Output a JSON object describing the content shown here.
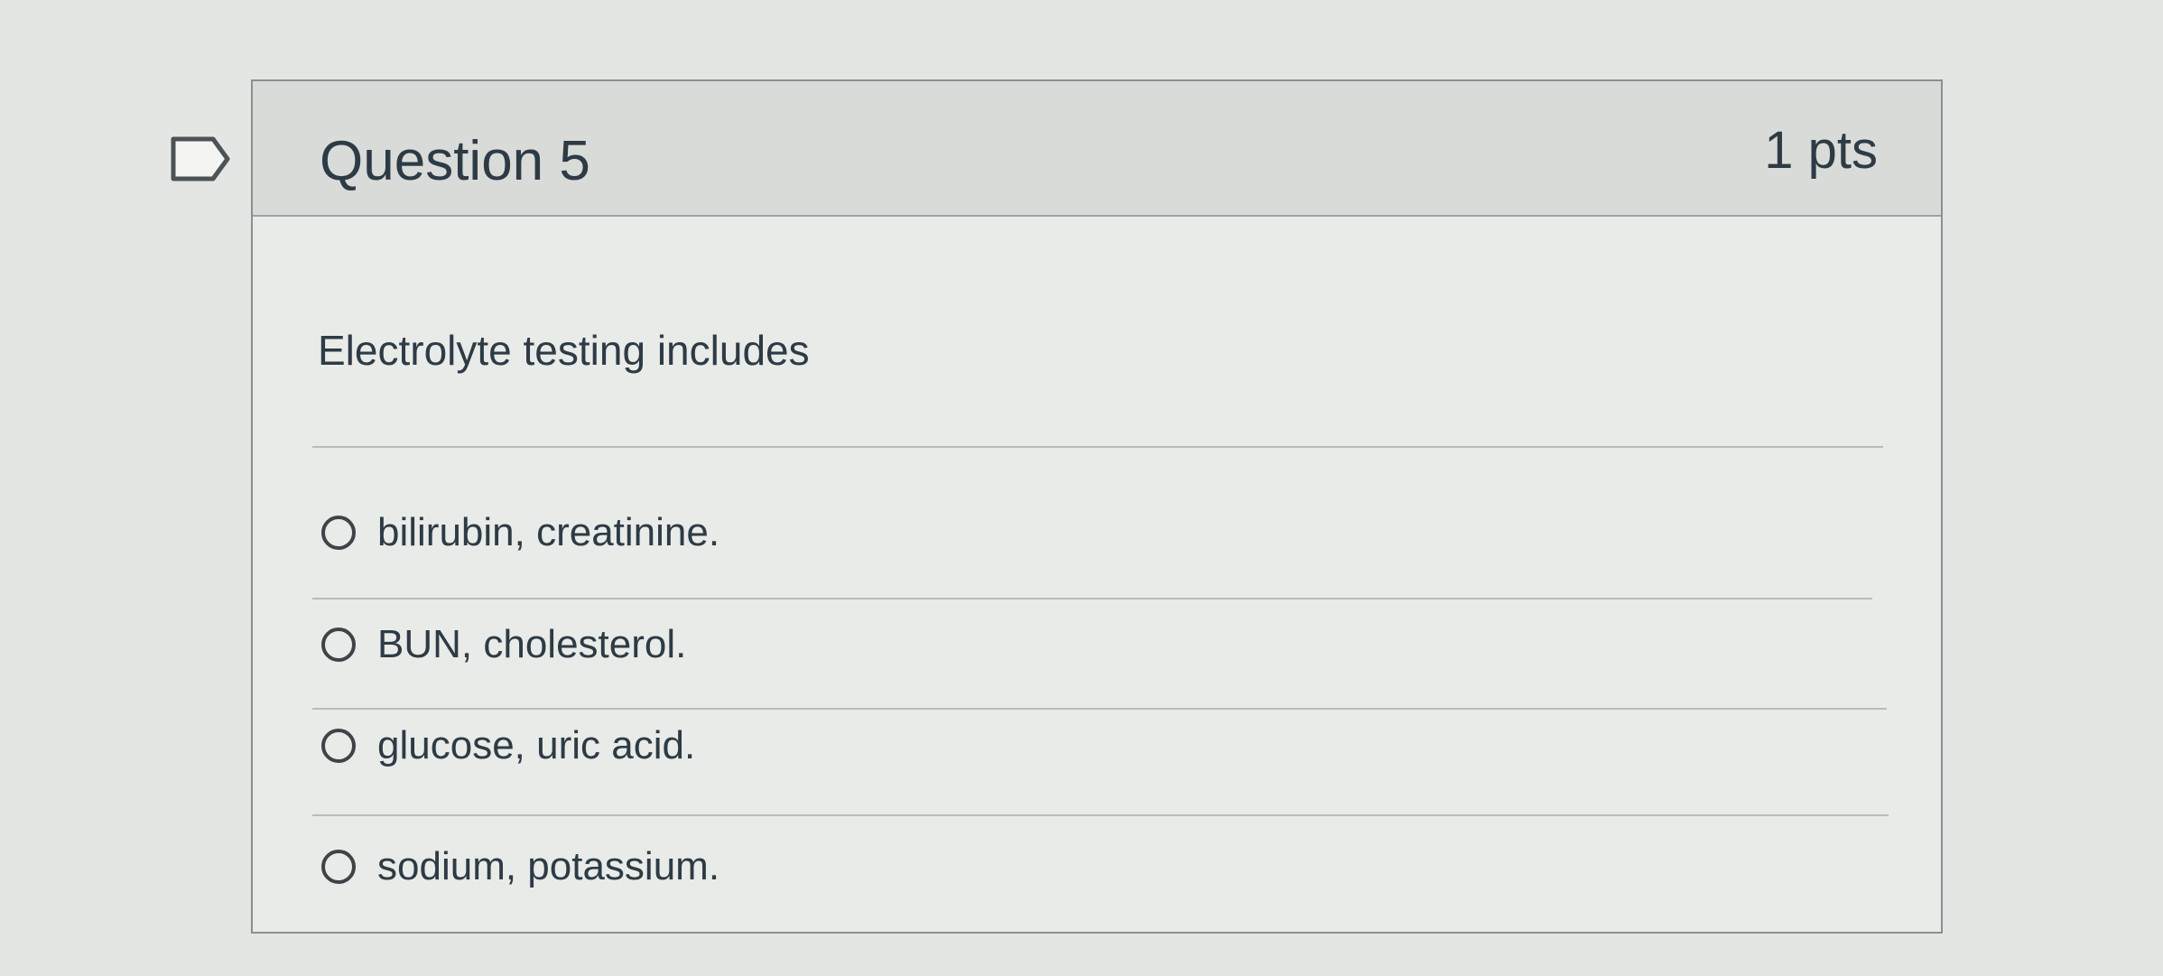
{
  "question": {
    "title": "Question 5",
    "points": "1 pts",
    "text": "Electrolyte testing includes",
    "answers": [
      {
        "label": "bilirubin, creatinine."
      },
      {
        "label": "BUN, cholesterol."
      },
      {
        "label": "glucose, uric acid."
      },
      {
        "label": "sodium, potassium."
      }
    ]
  },
  "icons": {
    "flag": "flag-icon",
    "radio": "radio-button-icon"
  },
  "colors": {
    "background": "#e4e6e3",
    "card": "#e9ebe8",
    "header": "#d9dbd9",
    "border": "#8a8f92",
    "text": "#2d3b45"
  }
}
